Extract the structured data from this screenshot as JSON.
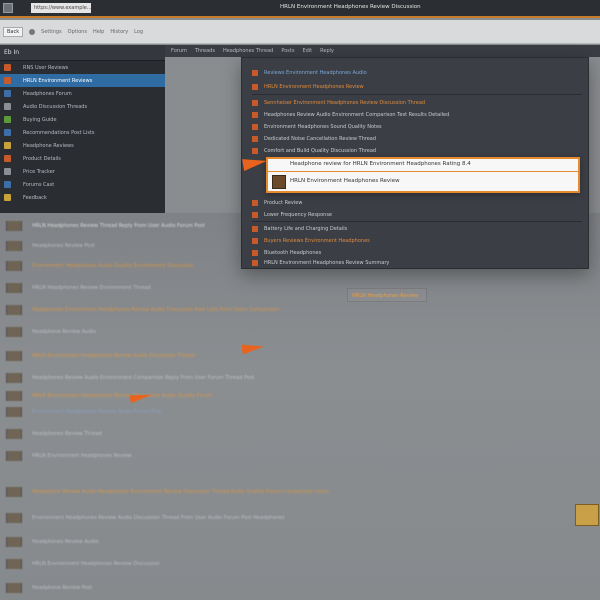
{
  "window": {
    "title": "HRLN Environment Headphones Review Discussion",
    "address": "https://www.example..."
  },
  "toolbar": {
    "back": "Back",
    "links": [
      "Settings",
      "Options",
      "Help",
      "History",
      "Log"
    ]
  },
  "left_panel": {
    "header": "Eb In",
    "items": [
      {
        "label": "RNS User  Reviews",
        "active": false
      },
      {
        "label": "HRLN Environment Reviews",
        "active": true
      },
      {
        "label": "Headphones Forum",
        "active": false
      },
      {
        "label": "Audio Discussion Threads",
        "active": false
      },
      {
        "label": "Buying Guide",
        "active": false
      },
      {
        "label": "Recommendations Post Lists",
        "active": false
      },
      {
        "label": "Headphone Reviews",
        "active": false
      },
      {
        "label": "Product Details",
        "active": false
      },
      {
        "label": "Price Tracker",
        "active": false
      },
      {
        "label": "Forums Cast",
        "active": false
      },
      {
        "label": "Feedback",
        "active": false
      }
    ]
  },
  "main_header": {
    "items": [
      "Forum",
      "Threads",
      "Headphones Thread",
      "Posts",
      "Edit",
      "Reply"
    ]
  },
  "popup": {
    "rows": [
      {
        "text": "Reviews  Environment Headphones Audio",
        "style": "blue"
      },
      {
        "text": "HRLN Environment Headphones Review",
        "style": "orange"
      },
      {
        "text": "Sennheiser Environment Headphones Review Discussion Thread",
        "style": "orange"
      },
      {
        "text": "Headphones Review Audio Environment Comparison Test Results Detailed",
        "style": "normal"
      },
      {
        "text": "Environment Headphones Sound Quality Notes",
        "style": "normal"
      },
      {
        "text": "Dedicated Noise Cancellation Review Thread",
        "style": "normal"
      },
      {
        "text": "Comfort and Build Quality Discussion Thread",
        "style": "normal"
      },
      {
        "text": "Product Review",
        "style": "normal"
      },
      {
        "text": "Lower Frequency Response",
        "style": "normal"
      },
      {
        "text": "Battery Life and Charging Details",
        "style": "normal"
      },
      {
        "text": "Buyers Reviews Environment Headphones",
        "style": "orange"
      },
      {
        "text": "Bluetooth Headphones",
        "style": "normal"
      },
      {
        "text": "Headphone Review Thread",
        "style": "normal"
      },
      {
        "text": "HRLN Environment Headphones Review Summary",
        "style": "normal"
      }
    ],
    "dialog": {
      "title": "Headphone review for HRLN Environment Headphones Rating 8.4",
      "text": "HRLN Environment Headphones Review"
    }
  },
  "lower_list": {
    "rows": [
      {
        "text": "HRLN Headphones Review Thread Reply From User Audio Forum Post",
        "style": "white"
      },
      {
        "text": "Headphones Review Post",
        "style": "normal"
      },
      {
        "text": "Environment Headphones Audio Quality Environment Discussion",
        "style": "orange"
      },
      {
        "text": "HRLN Headphones Review  Environment Thread",
        "style": "normal"
      },
      {
        "text": "Headphones Environment Headphones Review Audio Discussion Post Lists From Users Comparison",
        "style": "orange"
      },
      {
        "text": "Headphone Review Audio",
        "style": "normal"
      },
      {
        "text": "HRLN Environment Headphones Review Audio Discussion Thread",
        "style": "orange"
      },
      {
        "text": "Headphones Review Audio Environment Comparison Reply From User Forum Thread Post",
        "style": "normal"
      },
      {
        "text": "HRLN Environment Headphones Review Discussion Audio Quality Forum",
        "style": "orange"
      },
      {
        "text": "Environment Headphones Review Audio Forum Post",
        "style": "blue"
      },
      {
        "text": "Headphones Review Thread",
        "style": "normal"
      },
      {
        "text": "HRLN Environment Headphones Review",
        "style": "normal"
      },
      {
        "text": "Headphone Review Audio Headphones Environment Review Discussion Thread Audio Quality Forum Comparison Users",
        "style": "orange"
      },
      {
        "text": "Environment Headphones Review Audio Discussion Thread From User Audio Forum Post Headphones",
        "style": "normal"
      },
      {
        "text": "Headphones Review Audio",
        "style": "normal"
      },
      {
        "text": "HRLN Environment Headphones Review Discussion",
        "style": "normal"
      },
      {
        "text": "Headphone Review Post",
        "style": "normal"
      }
    ],
    "side_box": "HRLN Headphones Review"
  }
}
